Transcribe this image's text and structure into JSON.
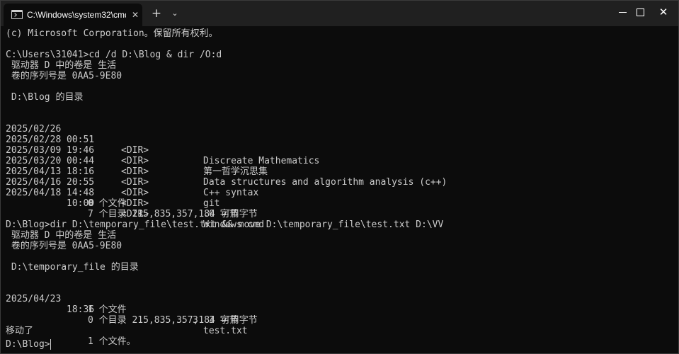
{
  "window": {
    "tab_title": "C:\\Windows\\system32\\cmd.ex",
    "tab_close_glyph": "✕",
    "new_tab_glyph": "+",
    "dropdown_glyph": "⌄",
    "minimize_icon": "minimize-icon",
    "maximize_icon": "maximize-icon",
    "close_glyph": "✕"
  },
  "terminal": {
    "copyright": "(c) Microsoft Corporation。保留所有权利。",
    "cmd1": "C:\\Users\\31041>cd /d D:\\Blog & dir /O:d",
    "volume1": " 驱动器 D 中的卷是 生活",
    "serial1": " 卷的序列号是 0AA5-9E80",
    "dirheader1": " D:\\Blog 的目录",
    "dir_entries": [
      {
        "date": "2025/02/26",
        "time": "00:51",
        "type": "<DIR>",
        "name": "Discreate Mathematics"
      },
      {
        "date": "2025/02/28",
        "time": "19:46",
        "type": "<DIR>",
        "name": "第一哲学沉思集"
      },
      {
        "date": "2025/03/09",
        "time": "00:44",
        "type": "<DIR>",
        "name": "Data structures and algorithm analysis (c++)"
      },
      {
        "date": "2025/03/20",
        "time": "18:16",
        "type": "<DIR>",
        "name": "C++ syntax"
      },
      {
        "date": "2025/04/13",
        "time": "20:55",
        "type": "<DIR>",
        "name": "git"
      },
      {
        "date": "2025/04/16",
        "time": "14:48",
        "type": "<DIR>",
        "name": "."
      },
      {
        "date": "2025/04/18",
        "time": "10:00",
        "type": "<DIR>",
        "name": "Windows cmd"
      }
    ],
    "summary1_files": "0 个文件",
    "summary1_bytes": "0 字节",
    "summary1_dirs": "7 个目录 215,835,357,184 可用字节",
    "cmd2": "D:\\Blog>dir D:\\temporary_file\\test.txt && move D:\\temporary_file\\test.txt D:\\VV",
    "volume2": " 驱动器 D 中的卷是 生活",
    "serial2": " 卷的序列号是 0AA5-9E80",
    "dirheader2": " D:\\temporary_file 的目录",
    "file_entry": {
      "date": "2025/04/23",
      "time": "18:36",
      "size": "3",
      "name": "test.txt"
    },
    "summary2_files": "1 个文件",
    "summary2_bytes": "3 字节",
    "summary2_dirs": "0 个目录 215,835,357,184 可用字节",
    "moved_label": "移动了",
    "moved_count": "1 个文件。",
    "prompt": "D:\\Blog>"
  }
}
